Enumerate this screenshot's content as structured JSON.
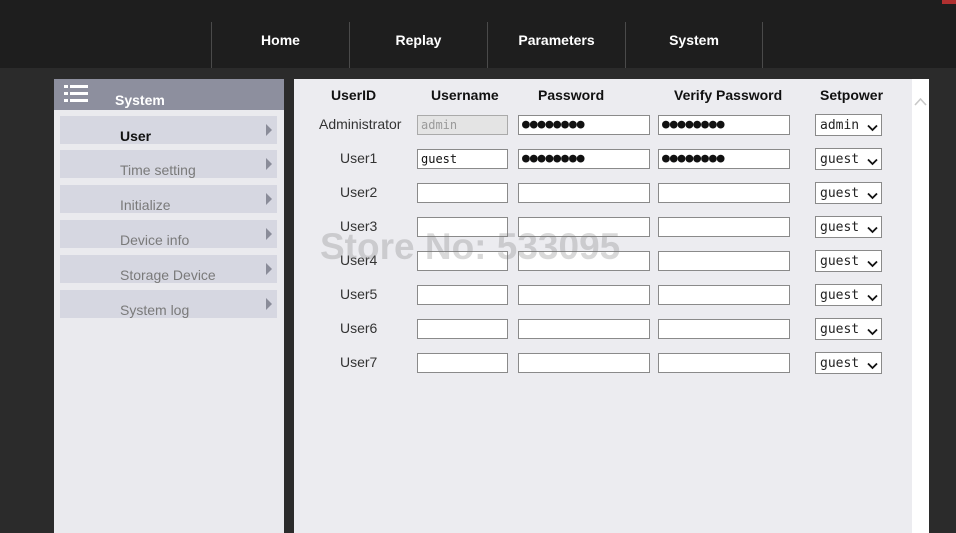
{
  "nav": {
    "items": [
      "Home",
      "Replay",
      "Parameters",
      "System"
    ]
  },
  "sidebar": {
    "header_icon": "list-icon",
    "title": "System",
    "items": [
      {
        "label": "User",
        "active": true
      },
      {
        "label": "Time setting",
        "active": false
      },
      {
        "label": "Initialize",
        "active": false
      },
      {
        "label": "Device info",
        "active": false
      },
      {
        "label": "Storage Device",
        "active": false
      },
      {
        "label": "System log",
        "active": false
      }
    ]
  },
  "table": {
    "headers": [
      "UserID",
      "Username",
      "Password",
      "Verify Password",
      "Setpower"
    ],
    "rows": [
      {
        "userid": "Administrator",
        "username": "admin",
        "username_disabled": true,
        "password": "●●●●●●●●",
        "verify": "●●●●●●●●",
        "power": "admin"
      },
      {
        "userid": "User1",
        "username": "guest",
        "username_disabled": false,
        "password": "●●●●●●●●",
        "verify": "●●●●●●●●",
        "power": "guest"
      },
      {
        "userid": "User2",
        "username": "",
        "username_disabled": false,
        "password": "",
        "verify": "",
        "power": "guest"
      },
      {
        "userid": "User3",
        "username": "",
        "username_disabled": false,
        "password": "",
        "verify": "",
        "power": "guest"
      },
      {
        "userid": "User4",
        "username": "",
        "username_disabled": false,
        "password": "",
        "verify": "",
        "power": "guest"
      },
      {
        "userid": "User5",
        "username": "",
        "username_disabled": false,
        "password": "",
        "verify": "",
        "power": "guest"
      },
      {
        "userid": "User6",
        "username": "",
        "username_disabled": false,
        "password": "",
        "verify": "",
        "power": "guest"
      },
      {
        "userid": "User7",
        "username": "",
        "username_disabled": false,
        "password": "",
        "verify": "",
        "power": "guest"
      }
    ]
  },
  "watermark": "Store No: 533095",
  "colors": {
    "topbar": "#1e1e1e",
    "sidebar_header": "#8d8f9e",
    "menu_item": "#d6d7e1",
    "content_bg": "#ececf0"
  }
}
